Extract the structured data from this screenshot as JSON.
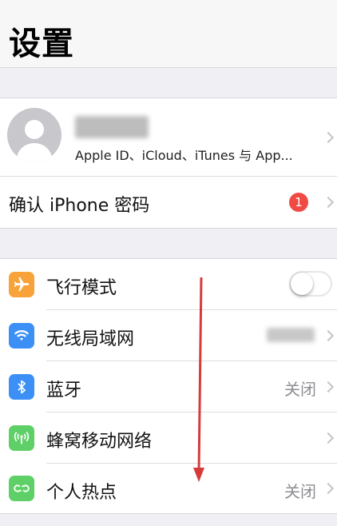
{
  "header": {
    "title": "设置"
  },
  "profile": {
    "subtitle": "Apple ID、iCloud、iTunes 与 App..."
  },
  "passcode_row": {
    "label": "确认 iPhone 密码",
    "badge": "1"
  },
  "settings": [
    {
      "id": "airplane",
      "label": "飞行模式",
      "icon": "airplane-icon",
      "color": "#f7a33a",
      "toggle_on": false
    },
    {
      "id": "wifi",
      "label": "无线局域网",
      "icon": "wifi-icon",
      "color": "#3b8ff5"
    },
    {
      "id": "bluetooth",
      "label": "蓝牙",
      "icon": "bluetooth-icon",
      "color": "#3b8ff5",
      "value": "关闭"
    },
    {
      "id": "cellular",
      "label": "蜂窝移动网络",
      "icon": "cellular-icon",
      "color": "#5fd068"
    },
    {
      "id": "hotspot",
      "label": "个人热点",
      "icon": "hotspot-icon",
      "color": "#5fd068",
      "value": "关闭"
    }
  ],
  "colors": {
    "annotation_arrow": "#d63b3b"
  }
}
